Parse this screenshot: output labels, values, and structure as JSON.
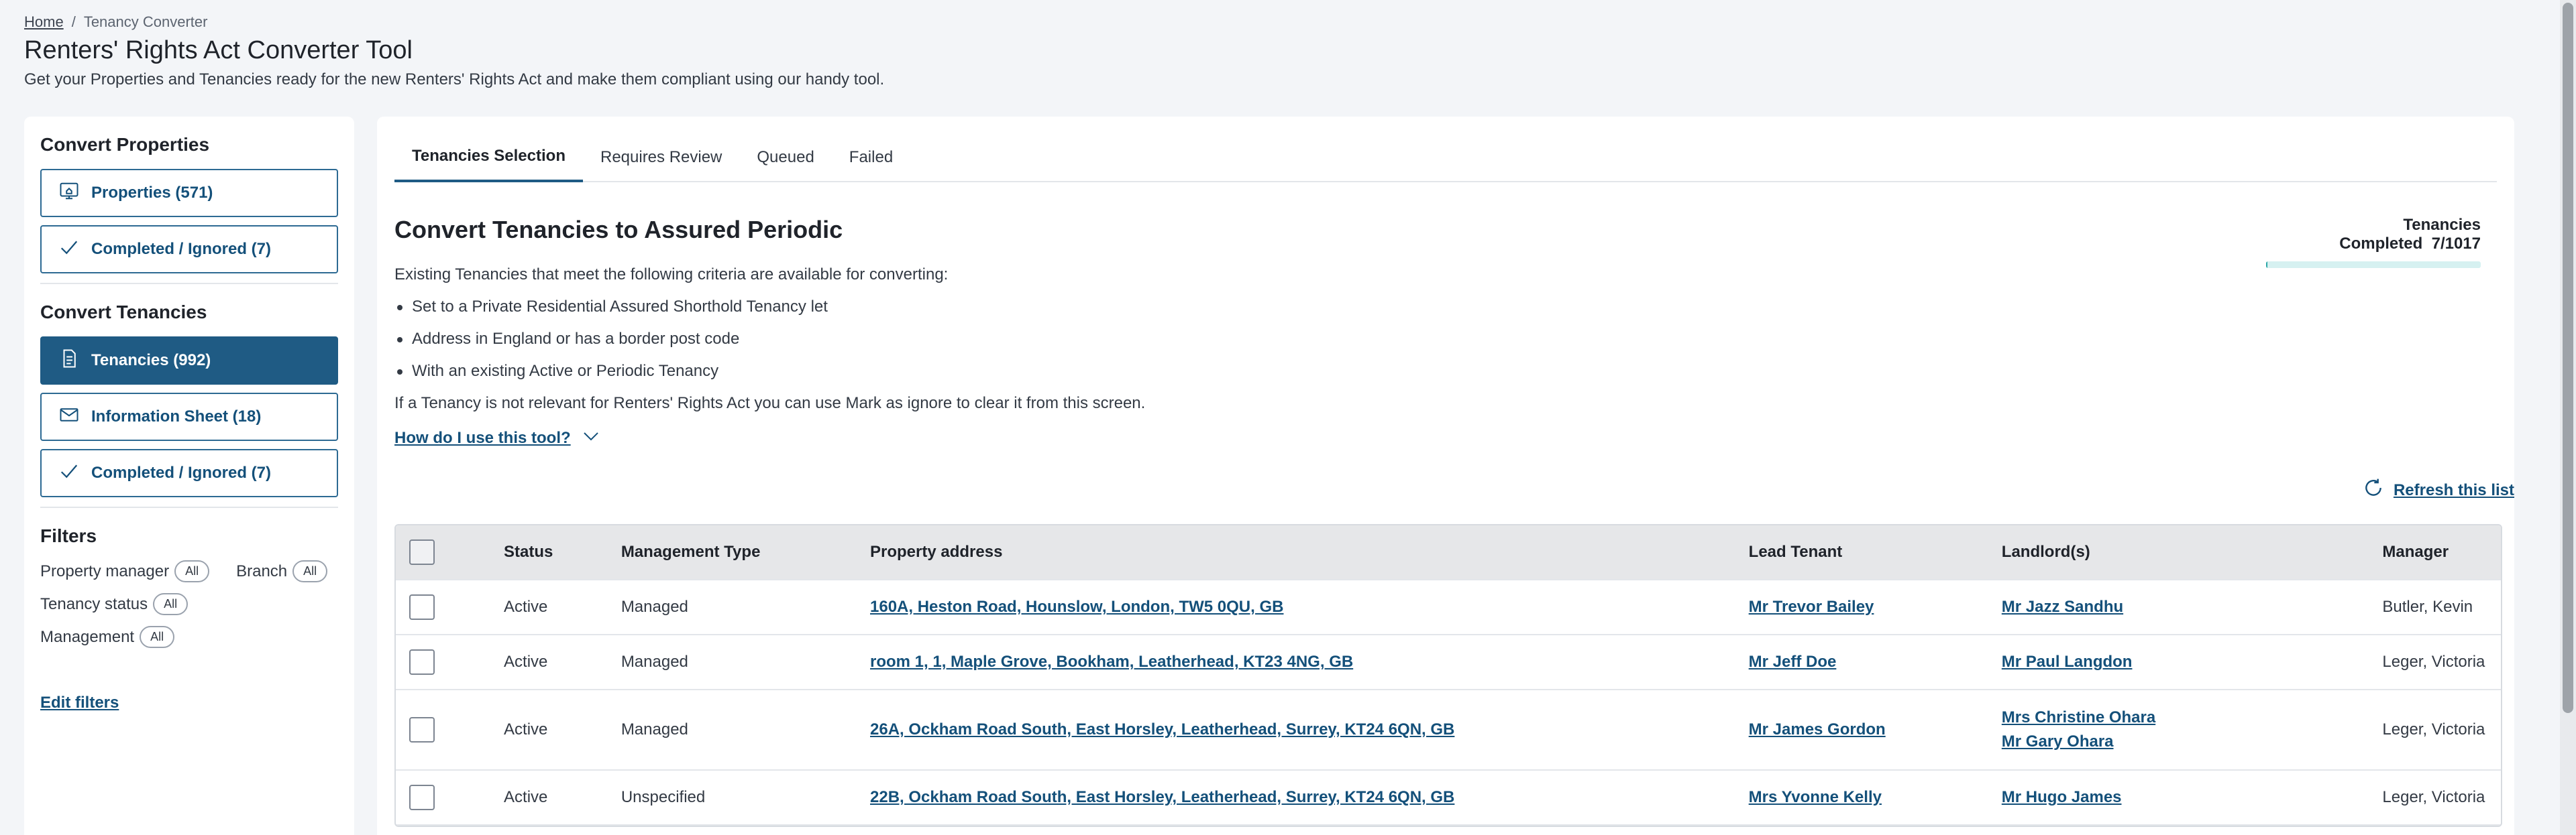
{
  "breadcrumb": {
    "home": "Home",
    "separator": "/",
    "current": "Tenancy Converter"
  },
  "header": {
    "title": "Renters' Rights Act Converter Tool",
    "subtitle": "Get your Properties and Tenancies ready for the new Renters' Rights Act and make them compliant using our handy tool."
  },
  "sidebar": {
    "properties_heading": "Convert Properties",
    "properties_btn": "Properties (571)",
    "properties_completed_btn": "Completed / Ignored (7)",
    "tenancies_heading": "Convert Tenancies",
    "tenancies_btn": "Tenancies (992)",
    "info_sheet_btn": "Information Sheet (18)",
    "tenancies_completed_btn": "Completed / Ignored (7)",
    "filters_title": "Filters",
    "filters": {
      "property_manager": "Property manager",
      "branch": "Branch",
      "tenancy_status": "Tenancy status",
      "management": "Management",
      "all": "All"
    },
    "edit_filters": "Edit filters"
  },
  "tabs": [
    "Tenancies Selection",
    "Requires Review",
    "Queued",
    "Failed"
  ],
  "main": {
    "title": "Convert Tenancies to Assured Periodic",
    "progress_label": "Tenancies Completed",
    "progress_value": "7/1017",
    "progress_fraction": 0.0069,
    "intro": "Existing Tenancies that meet the following criteria are available for converting:",
    "criteria": [
      "Set to a Private Residential Assured Shorthold Tenancy let",
      "Address in England or has a border post code",
      "With an existing Active or Periodic Tenancy"
    ],
    "note": "If a Tenancy is not relevant for Renters' Rights Act you can use Mark as ignore to clear it from this screen.",
    "howto": "How do I use this tool?",
    "refresh": "Refresh this list"
  },
  "table": {
    "headers": {
      "status": "Status",
      "management_type": "Management Type",
      "property_address": "Property address",
      "lead_tenant": "Lead Tenant",
      "landlords": "Landlord(s)",
      "manager": "Manager"
    },
    "rows": [
      {
        "status": "Active",
        "management_type": "Managed",
        "address": "160A, Heston Road, Hounslow, London, TW5 0QU, GB",
        "lead_tenant": "Mr Trevor Bailey",
        "landlord_1": "Mr Jazz Sandhu",
        "landlord_2": "",
        "manager": "Butler, Kevin"
      },
      {
        "status": "Active",
        "management_type": "Managed",
        "address": "room 1, 1, Maple Grove, Bookham, Leatherhead, KT23 4NG, GB",
        "lead_tenant": "Mr Jeff Doe",
        "landlord_1": "Mr Paul Langdon",
        "landlord_2": "",
        "manager": "Leger, Victoria"
      },
      {
        "status": "Active",
        "management_type": "Managed",
        "address": "26A, Ockham Road South, East Horsley, Leatherhead, Surrey, KT24 6QN, GB",
        "lead_tenant": "Mr James Gordon",
        "landlord_1": "Mrs Christine Ohara",
        "landlord_2": "Mr Gary Ohara",
        "manager": "Leger, Victoria"
      },
      {
        "status": "Active",
        "management_type": "Unspecified",
        "address": "22B, Ockham Road South, East Horsley, Leatherhead, Surrey, KT24 6QN, GB",
        "lead_tenant": "Mrs Yvonne Kelly",
        "landlord_1": "Mr Hugo James",
        "landlord_2": "",
        "manager": "Leger, Victoria"
      }
    ]
  },
  "colors": {
    "accent": "#1f5b84",
    "link": "#14507a",
    "progress": "#2aa7a7",
    "progress_track": "#d6f1f1"
  },
  "icons": [
    "home-search-icon",
    "check-icon",
    "document-icon",
    "envelope-icon",
    "chevron-down-icon",
    "refresh-icon"
  ]
}
